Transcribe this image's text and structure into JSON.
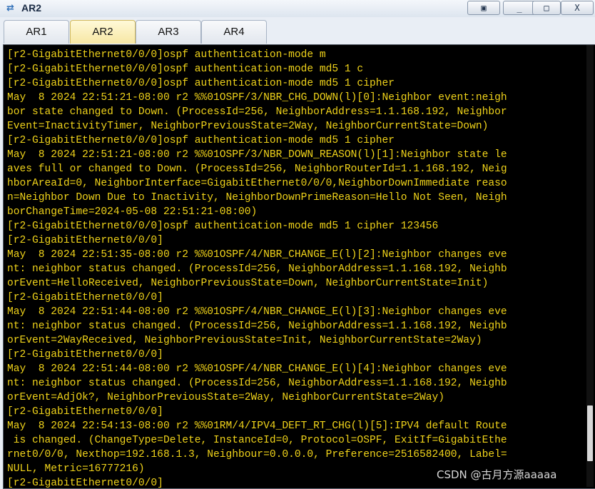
{
  "window": {
    "title": "AR2",
    "controls": [
      "restore",
      "minimize",
      "maximize",
      "close"
    ],
    "close_label": "X",
    "min_label": "_",
    "max_label": "□",
    "restore_label": "▣"
  },
  "tabs": [
    {
      "label": "AR1",
      "active": false
    },
    {
      "label": "AR2",
      "active": true
    },
    {
      "label": "AR3",
      "active": false
    },
    {
      "label": "AR4",
      "active": false
    }
  ],
  "console": {
    "lines": [
      "[r2-GigabitEthernet0/0/0]ospf authentication-mode m",
      "[r2-GigabitEthernet0/0/0]ospf authentication-mode md5 1 c",
      "[r2-GigabitEthernet0/0/0]ospf authentication-mode md5 1 cipher",
      "May  8 2024 22:51:21-08:00 r2 %%01OSPF/3/NBR_CHG_DOWN(l)[0]:Neighbor event:neigh",
      "bor state changed to Down. (ProcessId=256, NeighborAddress=1.1.168.192, Neighbor",
      "Event=InactivityTimer, NeighborPreviousState=2Way, NeighborCurrentState=Down)",
      "[r2-GigabitEthernet0/0/0]ospf authentication-mode md5 1 cipher",
      "May  8 2024 22:51:21-08:00 r2 %%01OSPF/3/NBR_DOWN_REASON(l)[1]:Neighbor state le",
      "aves full or changed to Down. (ProcessId=256, NeighborRouterId=1.1.168.192, Neig",
      "hborAreaId=0, NeighborInterface=GigabitEthernet0/0/0,NeighborDownImmediate reaso",
      "n=Neighbor Down Due to Inactivity, NeighborDownPrimeReason=Hello Not Seen, Neigh",
      "borChangeTime=2024-05-08 22:51:21-08:00)",
      "[r2-GigabitEthernet0/0/0]ospf authentication-mode md5 1 cipher 123456",
      "[r2-GigabitEthernet0/0/0]",
      "May  8 2024 22:51:35-08:00 r2 %%01OSPF/4/NBR_CHANGE_E(l)[2]:Neighbor changes eve",
      "nt: neighbor status changed. (ProcessId=256, NeighborAddress=1.1.168.192, Neighb",
      "orEvent=HelloReceived, NeighborPreviousState=Down, NeighborCurrentState=Init)",
      "[r2-GigabitEthernet0/0/0]",
      "May  8 2024 22:51:44-08:00 r2 %%01OSPF/4/NBR_CHANGE_E(l)[3]:Neighbor changes eve",
      "nt: neighbor status changed. (ProcessId=256, NeighborAddress=1.1.168.192, Neighb",
      "orEvent=2WayReceived, NeighborPreviousState=Init, NeighborCurrentState=2Way)",
      "[r2-GigabitEthernet0/0/0]",
      "May  8 2024 22:51:44-08:00 r2 %%01OSPF/4/NBR_CHANGE_E(l)[4]:Neighbor changes eve",
      "nt: neighbor status changed. (ProcessId=256, NeighborAddress=1.1.168.192, Neighb",
      "orEvent=AdjOk?, NeighborPreviousState=2Way, NeighborCurrentState=2Way)",
      "[r2-GigabitEthernet0/0/0]",
      "May  8 2024 22:54:13-08:00 r2 %%01RM/4/IPV4_DEFT_RT_CHG(l)[5]:IPV4 default Route",
      " is changed. (ChangeType=Delete, InstanceId=0, Protocol=OSPF, ExitIf=GigabitEthe",
      "rnet0/0/0, Nexthop=192.168.1.3, Neighbour=0.0.0.0, Preference=2516582400, Label=",
      "NULL, Metric=16777216)",
      "[r2-GigabitEthernet0/0/0]"
    ]
  },
  "watermark": "CSDN @古月方源aaaaa",
  "colors": {
    "terminal_bg": "#000000",
    "terminal_text": "#f0d31a",
    "active_tab": "#f7e7a4"
  }
}
